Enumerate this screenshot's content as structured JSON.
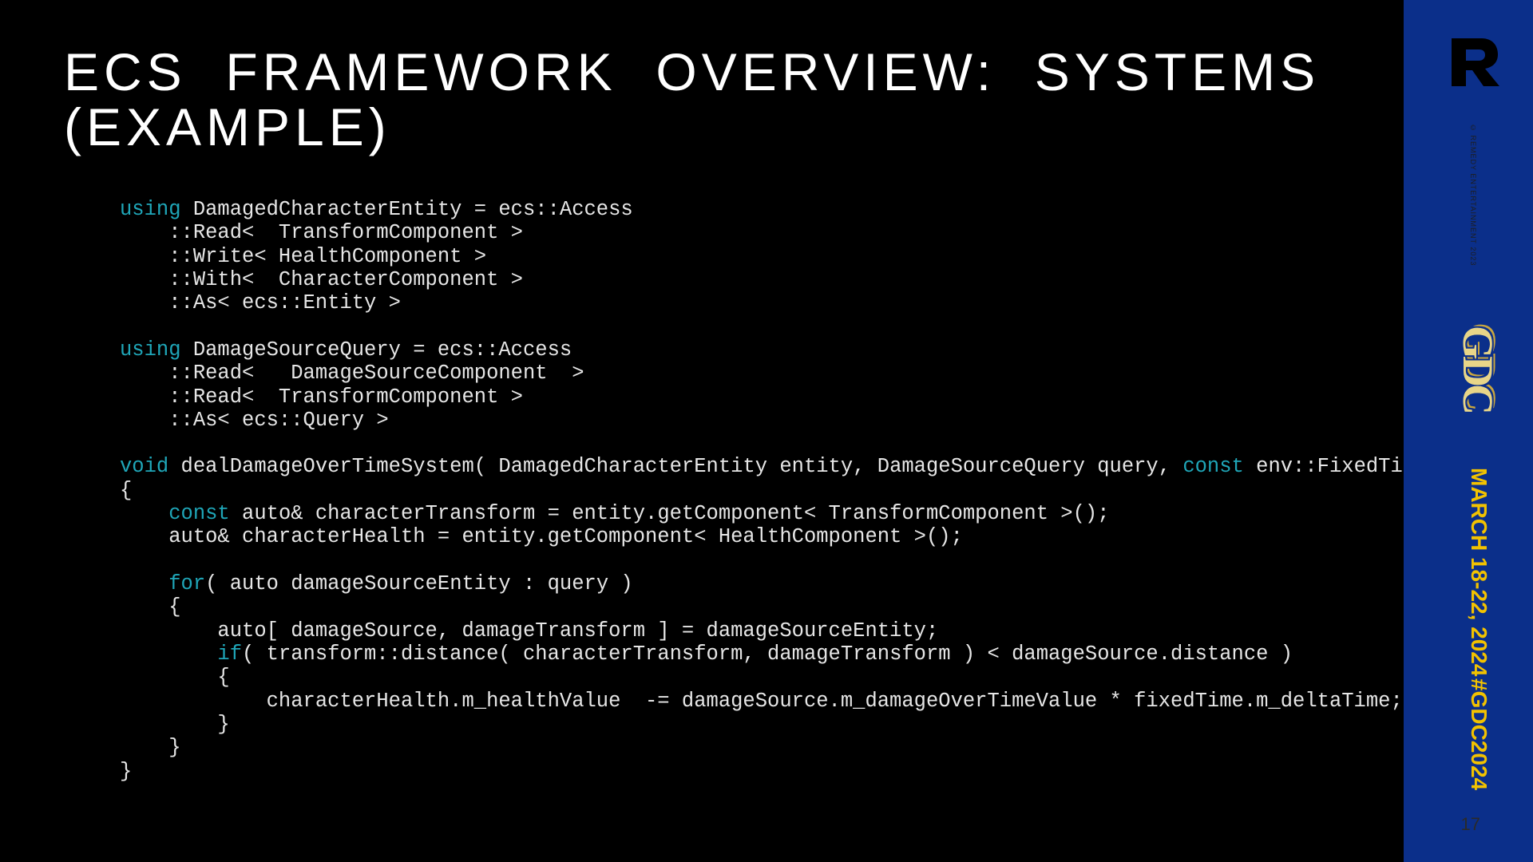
{
  "slide": {
    "title": "ECS  FRAMEWORK  OVERVIEW:  SYSTEMS\n(EXAMPLE)",
    "page_number": "17"
  },
  "sidebar": {
    "company_logo_text": "R",
    "copyright": "© REMEDY ENTERTAINMENT 2023",
    "conference_logo": "GDC",
    "conference_dates": "MARCH 18-22, 2024",
    "conference_hashtag": "#GDC2024"
  },
  "code": {
    "kw_using": "using",
    "kw_void": "void",
    "kw_const": "const",
    "kw_for": "for",
    "kw_if": "if",
    "l1": " DamagedCharacterEntity = ecs::Access",
    "l2": "    ::Read<  TransformComponent >",
    "l3": "    ::Write< HealthComponent >",
    "l4": "    ::With<  CharacterComponent >",
    "l5": "    ::As< ecs::Entity >",
    "blank": "",
    "l6": " DamageSourceQuery = ecs::Access",
    "l7": "    ::Read<   DamageSourceComponent  >",
    "l8": "    ::Read<  TransformComponent >",
    "l9": "    ::As< ecs::Query >",
    "l10a": " dealDamageOverTimeSystem( DamagedCharacterEntity entity, DamageSourceQuery query, ",
    "l10b": " env::FixedTime& fixedTime )",
    "l11": "{",
    "l12_indent": "    ",
    "l12": " auto& characterTransform = entity.getComponent< TransformComponent >();",
    "l13": "    auto& characterHealth = entity.getComponent< HealthComponent >();",
    "l14_indent": "    ",
    "l14": "( auto damageSourceEntity : query )",
    "l15": "    {",
    "l16": "        auto[ damageSource, damageTransform ] = damageSourceEntity;",
    "l17_indent": "        ",
    "l17": "( transform::distance( characterTransform, damageTransform ) < damageSource.distance )",
    "l18": "        {",
    "l19": "            characterHealth.m_healthValue  -= damageSource.m_damageOverTimeValue * fixedTime.m_deltaTime;",
    "l20": "        }",
    "l21": "    }",
    "l22": "}"
  }
}
